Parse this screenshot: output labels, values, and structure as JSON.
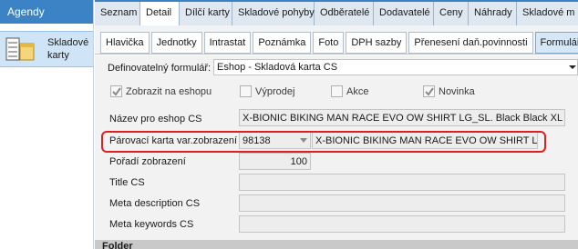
{
  "agenda": {
    "title": "Agendy",
    "item_label": "Skladové karty",
    "icon": "stock-cards-icon"
  },
  "top_tabs": [
    {
      "label": "Seznam",
      "active": false
    },
    {
      "label": "Detail",
      "active": true
    },
    {
      "label": "Dílčí karty",
      "active": false
    },
    {
      "label": "Skladové pohyby",
      "active": false
    },
    {
      "label": "Odběratelé",
      "active": false
    },
    {
      "label": "Dodavatelé",
      "active": false
    },
    {
      "label": "Ceny",
      "active": false
    },
    {
      "label": "Náhrady",
      "active": false
    },
    {
      "label": "Skladové m",
      "active": false
    }
  ],
  "sub_tabs": [
    {
      "label": "Hlavička",
      "active": false
    },
    {
      "label": "Jednotky",
      "active": false
    },
    {
      "label": "Intrastat",
      "active": false
    },
    {
      "label": "Poznámka",
      "active": false
    },
    {
      "label": "Foto",
      "active": false
    },
    {
      "label": "DPH sazby",
      "active": false
    },
    {
      "label": "Přenesení daň.povinnosti",
      "active": false
    },
    {
      "label": "Formuláře",
      "active": true
    }
  ],
  "form": {
    "definable_form_label": "Definovatelný formulář:",
    "definable_form_value": "Eshop - Skladová karta CS",
    "checkboxes": {
      "show_on_eshop": {
        "label": "Zobrazit na eshopu",
        "checked": true
      },
      "sale": {
        "label": "Výprodej",
        "checked": false
      },
      "action": {
        "label": "Akce",
        "checked": false
      },
      "new": {
        "label": "Novinka",
        "checked": true
      }
    },
    "name_label": "Název pro eshop CS",
    "name_value": "X-BIONIC BIKING MAN RACE EVO OW SHIRT LG_SL. Black Black XL",
    "pairing_label": "Párovací karta var.zobrazení",
    "pairing_code": "98138",
    "pairing_name": "X-BIONIC BIKING MAN RACE EVO OW SHIRT LG_S",
    "order_label": "Pořadí zobrazení",
    "order_value": "100",
    "title_label": "Title CS",
    "title_value": "",
    "meta_desc_label": "Meta description CS",
    "meta_desc_value": "",
    "meta_keywords_label": "Meta keywords CS",
    "meta_keywords_value": "",
    "folder_label": "Folder"
  },
  "colors": {
    "header_blue": "#3b83c4",
    "highlight_red": "#e02020",
    "selected_item": "#cfe5f7"
  }
}
